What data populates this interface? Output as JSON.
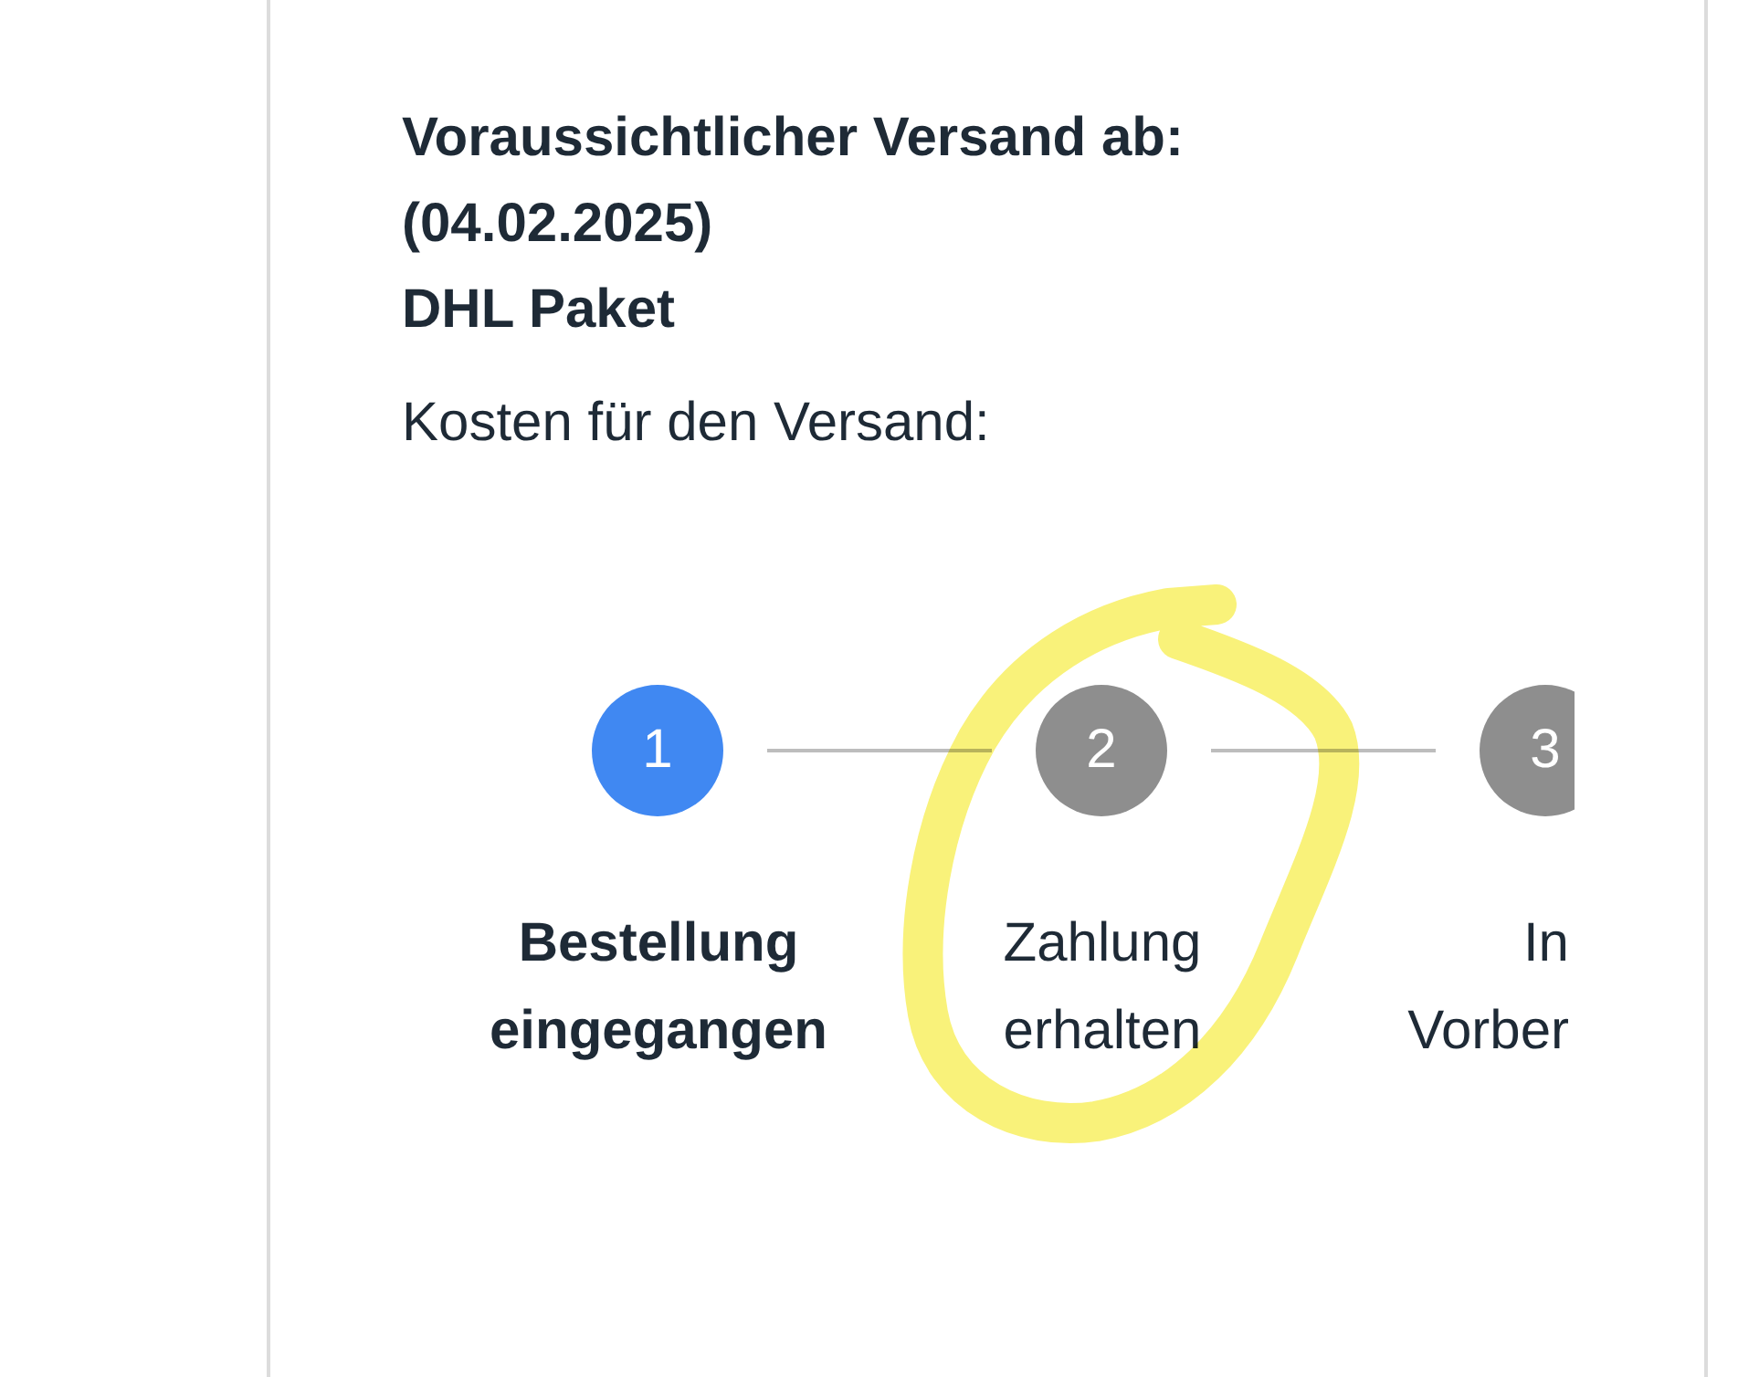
{
  "shipping": {
    "estimate_label": "Voraussichtlicher Versand ab:",
    "estimate_date": "(04.02.2025)",
    "carrier": "DHL Paket",
    "cost_label": "Kosten für den Versand:"
  },
  "steps": [
    {
      "number": "1",
      "label_lines": [
        "Bestellung",
        "eingegangen"
      ],
      "active": true
    },
    {
      "number": "2",
      "label_lines": [
        "Zahlung",
        "erhalten"
      ],
      "active": false
    },
    {
      "number": "3",
      "label_lines": [
        "In",
        "Vorber"
      ],
      "active": false
    }
  ]
}
